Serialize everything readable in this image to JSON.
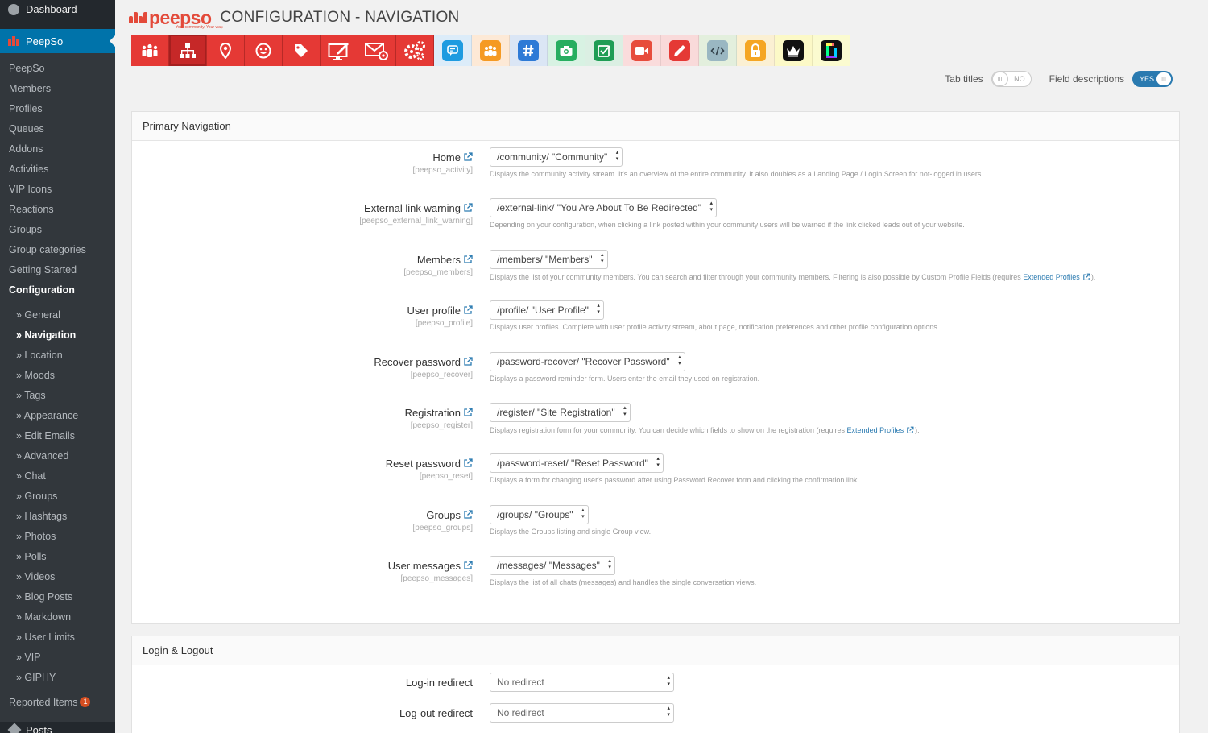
{
  "sidebar": {
    "dashboard": "Dashboard",
    "peepso": "PeepSo",
    "items": [
      "PeepSo",
      "Members",
      "Profiles",
      "Queues",
      "Addons",
      "Activities",
      "VIP Icons",
      "Reactions",
      "Groups",
      "Group categories",
      "Getting Started"
    ],
    "configuration": "Configuration",
    "config_items": [
      "» General",
      "» Navigation",
      "» Location",
      "» Moods",
      "» Tags",
      "» Appearance",
      "» Edit Emails",
      "» Advanced",
      "» Chat",
      "» Groups",
      "» Hashtags",
      "» Photos",
      "» Polls",
      "» Videos",
      "» Blog Posts",
      "» Markdown",
      "» User Limits",
      "» VIP",
      "» GIPHY"
    ],
    "current_config": "» Navigation",
    "reported": "Reported Items",
    "reported_count": "1",
    "posts": "Posts"
  },
  "header": {
    "logo": "peepso",
    "tagline": "Your community. Your way.",
    "title": "CONFIGURATION  -  NAVIGATION"
  },
  "toolbar": {
    "core_icons": [
      "people-icon",
      "sitemap-icon",
      "location-pin-icon",
      "smiley-icon",
      "tag-icon",
      "monitor-edit-icon",
      "envelope-gear-icon",
      "gears-icon"
    ],
    "addon_icons": [
      {
        "name": "chat-bubble-icon",
        "bg": "#dcecf9",
        "badge": "#1e9be0"
      },
      {
        "name": "groups-icon",
        "bg": "#fde9d6",
        "badge": "#f59a23"
      },
      {
        "name": "hashtag-icon",
        "bg": "#dbe6f5",
        "badge": "#2d7ad6"
      },
      {
        "name": "camera-icon",
        "bg": "#d8f2e3",
        "badge": "#27ae60"
      },
      {
        "name": "poll-check-icon",
        "bg": "#dbefe3",
        "badge": "#1f9d55"
      },
      {
        "name": "video-camera-icon",
        "bg": "#fadcdc",
        "badge": "#e74c3c"
      },
      {
        "name": "pencil-icon",
        "bg": "#f9dada",
        "badge": "#e53935"
      },
      {
        "name": "markdown-code-icon",
        "bg": "#e3efdd",
        "badge": "#9ab7c2"
      },
      {
        "name": "lock-icon",
        "bg": "#fbf0d3",
        "badge": "#f5a623"
      },
      {
        "name": "crown-icon",
        "bg": "#fcf9c7",
        "badge": "#111111"
      },
      {
        "name": "giphy-icon",
        "bg": "#fbfbd0",
        "badge": "#111111"
      }
    ]
  },
  "toggles": {
    "tab_titles_label": "Tab titles",
    "tab_titles_value": "NO",
    "field_desc_label": "Field descriptions",
    "field_desc_value": "YES",
    "knob": "III"
  },
  "primary": {
    "title": "Primary Navigation",
    "rows": [
      {
        "label": "Home",
        "key": "[peepso_activity]",
        "value": "/community/ \"Community\"",
        "desc": "Displays the community activity stream. It's an overview of the entire community. It also doubles as a Landing Page / Login Screen for not-logged in users."
      },
      {
        "label": "External link warning",
        "key": "[peepso_external_link_warning]",
        "value": "/external-link/ \"You Are About To Be Redirected\"",
        "desc": "Depending on your configuration, when clicking a link posted within your community users will be warned if the link clicked leads out of your website."
      },
      {
        "label": "Members",
        "key": "[peepso_members]",
        "value": "/members/ \"Members\"",
        "desc": "Displays the list of your community members. You can search and filter through your community members. Filtering is also possible by Custom Profile Fields (requires ",
        "link": "Extended Profiles",
        "desc_end": ")."
      },
      {
        "label": "User profile",
        "key": "[peepso_profile]",
        "value": "/profile/ \"User Profile\"",
        "desc": "Displays user profiles. Complete with user profile activity stream, about page, notification preferences and other profile configuration options."
      },
      {
        "label": "Recover password",
        "key": "[peepso_recover]",
        "value": "/password-recover/ \"Recover Password\"",
        "desc": "Displays a password reminder form. Users enter the email they used on registration."
      },
      {
        "label": "Registration",
        "key": "[peepso_register]",
        "value": "/register/ \"Site Registration\"",
        "desc": "Displays registration form for your community. You can decide which fields to show on the registration (requires ",
        "link": "Extended Profiles",
        "desc_end": ")."
      },
      {
        "label": "Reset password",
        "key": "[peepso_reset]",
        "value": "/password-reset/ \"Reset Password\"",
        "desc": "Displays a form for changing user's password after using Password Recover form and clicking the confirmation link."
      },
      {
        "label": "Groups",
        "key": "[peepso_groups]",
        "value": "/groups/ \"Groups\"",
        "desc": "Displays the Groups listing and single Group view."
      },
      {
        "label": "User messages",
        "key": "[peepso_messages]",
        "value": "/messages/ \"Messages\"",
        "desc": "Displays the list of all chats (messages) and handles the single conversation views."
      }
    ]
  },
  "login": {
    "title": "Login & Logout",
    "rows": [
      {
        "label": "Log-in redirect",
        "value": "No redirect"
      },
      {
        "label": "Log-out redirect",
        "value": "No redirect"
      }
    ]
  }
}
